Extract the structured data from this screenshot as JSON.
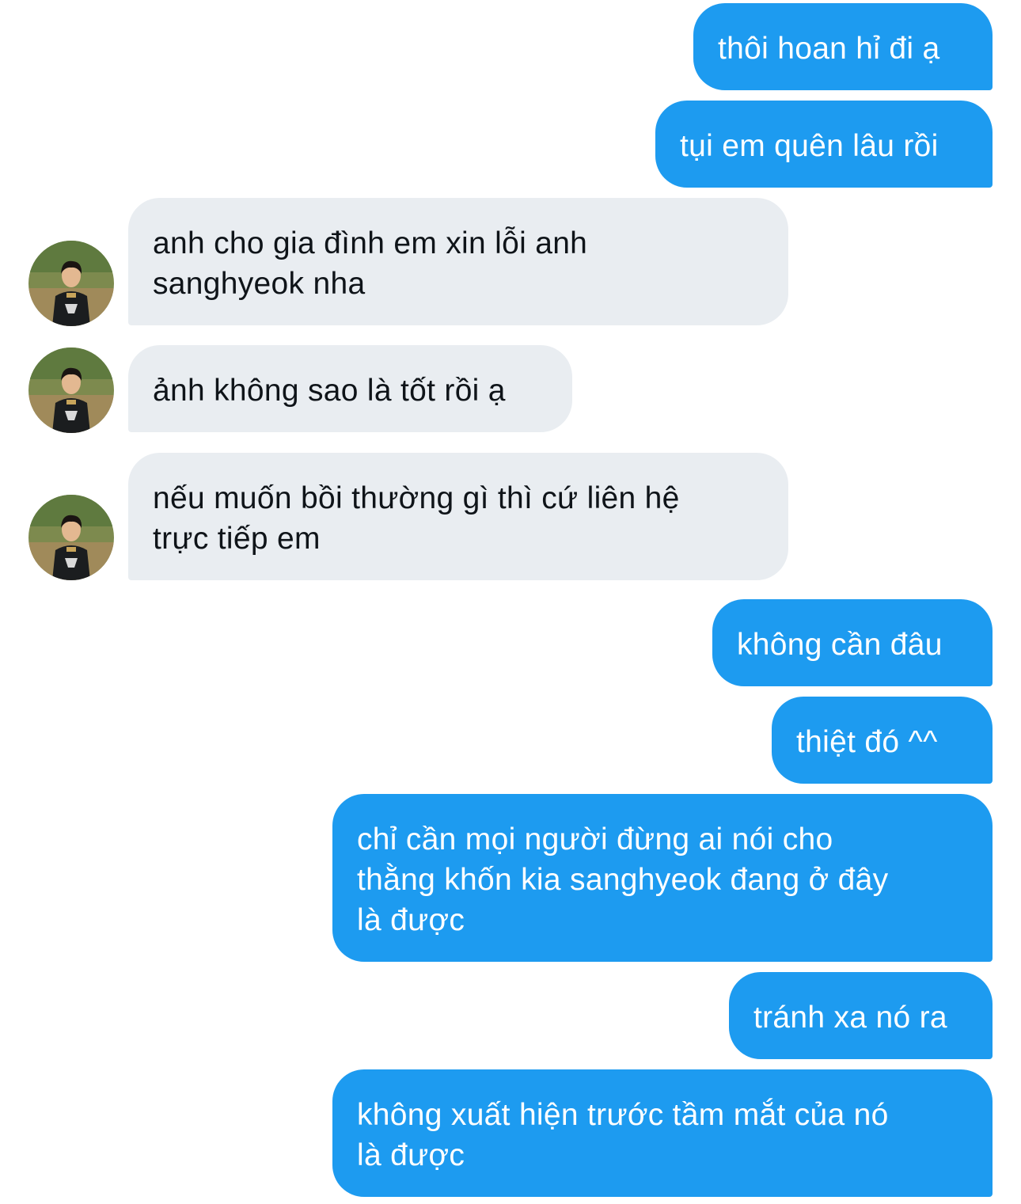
{
  "messages": [
    {
      "side": "out",
      "text": "thôi hoan hỉ đi ạ"
    },
    {
      "side": "out",
      "text": "tụi em quên lâu rồi"
    },
    {
      "side": "in",
      "text": "anh cho gia đình em xin lỗi anh\nsanghyeok nha"
    },
    {
      "side": "in",
      "text": "ảnh không sao là tốt rồi ạ"
    },
    {
      "side": "in",
      "text": "nếu muốn bồi thường gì thì cứ liên hệ\ntrực tiếp em"
    },
    {
      "side": "out",
      "text": "không cần đâu"
    },
    {
      "side": "out",
      "text": "thiệt đó ^^"
    },
    {
      "side": "out",
      "text": "chỉ cần mọi người đừng ai nói cho\nthằng khốn kia sanghyeok đang ở đây\nlà được"
    },
    {
      "side": "out",
      "text": "tránh xa nó ra"
    },
    {
      "side": "out",
      "text": "không xuất hiện trước tầm mắt của nó\nlà được"
    }
  ],
  "colors": {
    "outgoing_bubble": "#1d9bf0",
    "incoming_bubble": "#e9edf1",
    "incoming_text": "#0f1419",
    "outgoing_text": "#ffffff"
  },
  "icons": {
    "avatar": "user-avatar-photo"
  }
}
